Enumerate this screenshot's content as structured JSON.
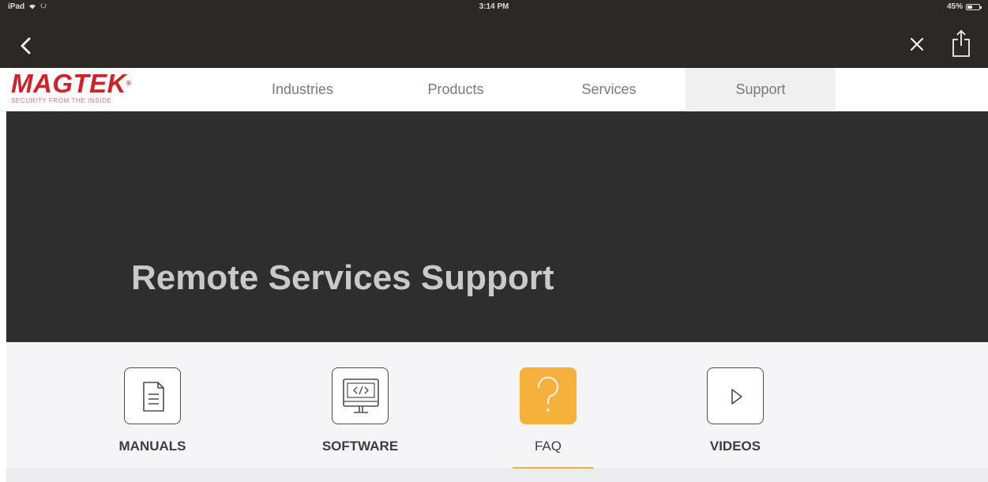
{
  "status_bar": {
    "device": "iPad",
    "time": "3:14 PM",
    "battery_percent": "45%",
    "battery_level": 0.45
  },
  "browser": {
    "back_icon": "chevron-left-icon",
    "close_icon": "close-icon",
    "share_icon": "share-icon"
  },
  "brand": {
    "name": "MAGTEK",
    "registered": "®",
    "tagline": "SECURITY FROM THE INSIDE",
    "color": "#d22129"
  },
  "nav": {
    "items": [
      {
        "label": "Industries"
      },
      {
        "label": "Products"
      },
      {
        "label": "Services"
      },
      {
        "label": "Support"
      }
    ],
    "active": "Support"
  },
  "hero": {
    "title": "Remote Services Support"
  },
  "categories": {
    "items": [
      {
        "label": "MANUALS",
        "icon": "document-icon"
      },
      {
        "label": "SOFTWARE",
        "icon": "code-monitor-icon"
      },
      {
        "label": "FAQ",
        "icon": "question-icon"
      },
      {
        "label": "VIDEOS",
        "icon": "play-icon"
      }
    ],
    "active": "FAQ",
    "accent_color": "#f6b13c"
  }
}
